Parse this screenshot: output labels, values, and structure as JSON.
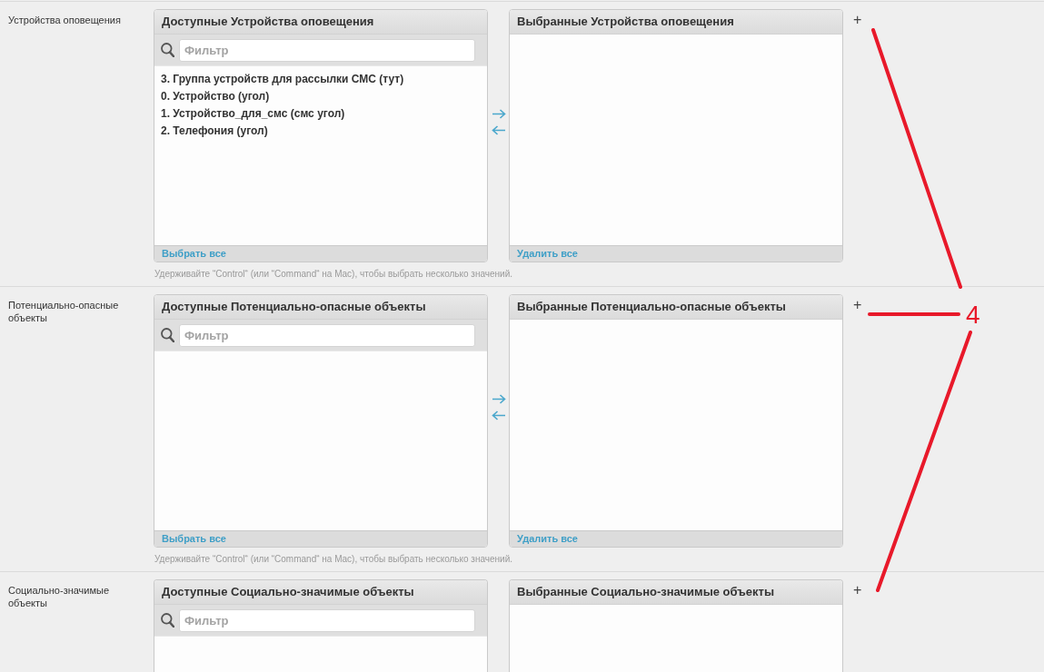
{
  "fields": [
    {
      "label": "Устройства оповещения",
      "available": {
        "title": "Доступные Устройства оповещения",
        "filter": {
          "placeholder": "Фильтр"
        },
        "options": [
          "3. Группа устройств для рассылки СМС (тут)",
          "0. Устройство (угол)",
          "1. Устройство_для_смс (смс угол)",
          "2. Телефония (угол)"
        ],
        "action": "Выбрать все"
      },
      "transfer_arrows": true,
      "chosen": {
        "title": "Выбранные Устройства оповещения",
        "action": "Удалить все"
      },
      "add_label": "+",
      "help": "Удерживайте “Control“ (или “Command“ на Mac), чтобы выбрать несколько значений."
    },
    {
      "label": "Потенциально-опасные объекты",
      "available": {
        "title": "Доступные Потенциально-опасные объекты",
        "filter": {
          "placeholder": "Фильтр"
        },
        "action": "Выбрать все"
      },
      "transfer_arrows": true,
      "chosen": {
        "title": "Выбранные Потенциально-опасные объекты",
        "action": "Удалить все"
      },
      "add_label": "+",
      "help": "Удерживайте “Control“ (или “Command“ на Mac), чтобы выбрать несколько значений."
    },
    {
      "label": "Социально-значимые объекты",
      "available": {
        "title": "Доступные Социально-значимые объекты",
        "filter": {
          "placeholder": "Фильтр"
        }
      },
      "chosen": {
        "title": "Выбранные Социально-значимые объекты"
      },
      "add_label": "+"
    }
  ],
  "annotation": {
    "label": "4"
  }
}
